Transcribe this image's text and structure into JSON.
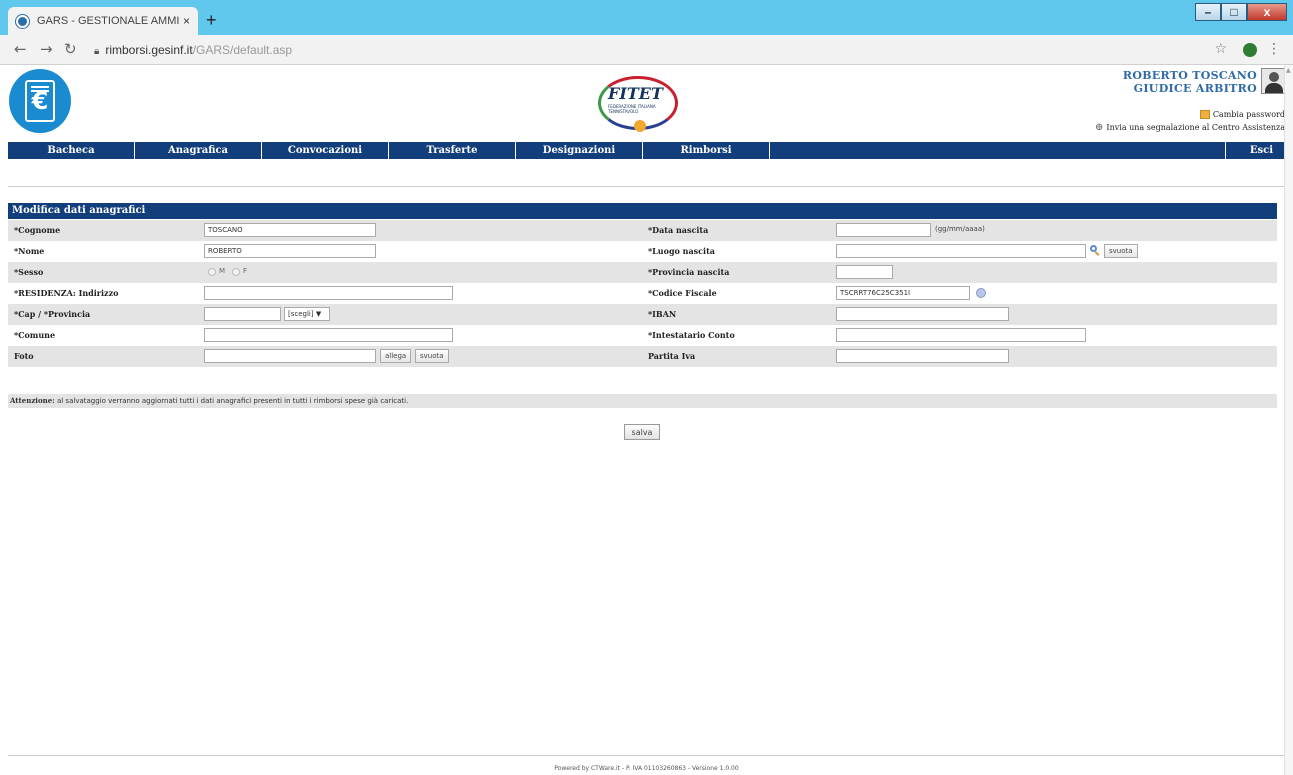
{
  "browser": {
    "tab_title": "GARS - GESTIONALE AMMINISTI",
    "tab_close": "×",
    "new_tab": "+",
    "url_host": "rimborsi.gesinf.it",
    "url_path": "/GARS/default.asp",
    "window_buttons": [
      "–",
      "□",
      "x"
    ]
  },
  "header": {
    "logo_symbol": "€",
    "fitet_word": "FITET",
    "fitet_sub": "FEDERAZIONE ITALIANA TENNISTAVOLO",
    "user_name": "ROBERTO TOSCANO",
    "user_role": "GIUDICE ARBITRO",
    "change_password": "Cambia password",
    "help_link": "Invia una segnalazione al Centro Assistenza"
  },
  "menu": {
    "items": [
      "Bacheca",
      "Anagrafica",
      "Convocazioni",
      "Trasferte",
      "Designazioni",
      "Rimborsi"
    ],
    "exit": "Esci"
  },
  "form": {
    "title": "Modifica dati anagrafici",
    "left": {
      "cognome_label": "*Cognome",
      "cognome_value": "TOSCANO",
      "nome_label": "*Nome",
      "nome_value": "ROBERTO",
      "sesso_label": "*Sesso",
      "sesso_m": "M",
      "sesso_f": "F",
      "indirizzo_label": "*RESIDENZA: Indirizzo",
      "indirizzo_value": "",
      "cap_label": "*Cap / *Provincia",
      "cap_value": "",
      "provincia_select": "[scegli] ▼",
      "comune_label": "*Comune",
      "comune_value": "",
      "foto_label": "Foto",
      "foto_value": "",
      "allega_button": "allega",
      "svuota_button": "svuota"
    },
    "right": {
      "data_label": "*Data nascita",
      "data_value": "",
      "data_hint": "(gg/mm/aaaa)",
      "luogo_label": "*Luogo nascita",
      "luogo_value": "",
      "luogo_svuota": "svuota",
      "prov_label": "*Provincia nascita",
      "prov_value": "",
      "cf_label": "*Codice Fiscale",
      "cf_value": "TSCRRT76C25C351I",
      "iban_label": "*IBAN",
      "iban_value": "",
      "intestatario_label": "*Intestatario Conto",
      "intestatario_value": "",
      "piva_label": "Partita Iva",
      "piva_value": ""
    },
    "attention_bold": "Attenzione:",
    "attention_text": " al salvataggio verranno aggiornati tutti i dati anagrafici presenti in tutti i rimborsi spese già caricati.",
    "save_button": "salva"
  },
  "footer": {
    "text": "Powered by CTWare.it - P. IVA 01103260863 - Versione 1.0.00"
  },
  "colors": {
    "nav_blue": "#123f7b",
    "browser_cyan": "#60c7ed",
    "user_blue": "#2e6aa8"
  }
}
